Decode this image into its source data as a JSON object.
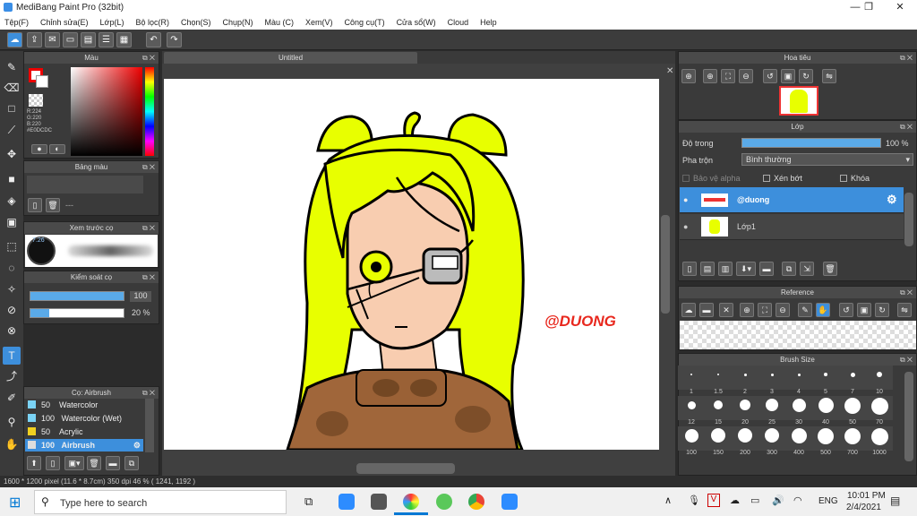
{
  "window": {
    "title": "MediBang Paint Pro (32bit)",
    "min": "—",
    "max": "❐",
    "close": "✕"
  },
  "menu": [
    "Tệp(F)",
    "Chỉnh sửa(E)",
    "Lớp(L)",
    "Bộ lọc(R)",
    "Chọn(S)",
    "Chụp(N)",
    "Màu (C)",
    "Xem(V)",
    "Công cụ(T)",
    "Cửa sổ(W)",
    "Cloud",
    "Help"
  ],
  "color_panel": {
    "title": "Màu",
    "r": "R:224",
    "g": "G:220",
    "b": "B:220",
    "hex": "#E0DCDC"
  },
  "palette_panel": {
    "title": "Bảng màu",
    "dash": "---"
  },
  "preview_panel": {
    "title": "Xem trước cọ",
    "size": "7.26"
  },
  "brush_control": {
    "title": "Kiểm soát cọ",
    "size_value": "100",
    "opacity_value": "20 %"
  },
  "brush_list": {
    "title": "Cọ: Airbrush",
    "items": [
      {
        "size": "50",
        "name": "Watercolor"
      },
      {
        "size": "100",
        "name": "Watercolor (Wet)"
      },
      {
        "size": "50",
        "name": "Acrylic"
      },
      {
        "size": "100",
        "name": "Airbrush"
      }
    ]
  },
  "document": {
    "tab_title": "Untitled",
    "signature": "@DUONG"
  },
  "navigator": {
    "title": "Hoa tiêu"
  },
  "layer_panel": {
    "title": "Lớp",
    "opacity_label": "Độ trong",
    "opacity_value": "100 %",
    "blend_label": "Pha trộn",
    "blend_value": "Bình thường",
    "protect_alpha": "Bảo vệ alpha",
    "clipping": "Xén bớt",
    "lock": "Khóa",
    "layers": [
      {
        "name": "@duong"
      },
      {
        "name": "Lớp1"
      }
    ]
  },
  "reference_panel": {
    "title": "Reference"
  },
  "brush_size_panel": {
    "title": "Brush Size",
    "sizes": [
      "1",
      "1.5",
      "2",
      "3",
      "4",
      "5",
      "7",
      "10",
      "12",
      "15",
      "20",
      "25",
      "30",
      "40",
      "50",
      "70",
      "100",
      "150",
      "200",
      "300",
      "400",
      "500",
      "700",
      "1000"
    ]
  },
  "status": {
    "text": "1600 * 1200 pixel   (11.6 * 8.7cm)   350 dpi   46 %   ( 1241, 1192 )"
  },
  "taskbar": {
    "search_placeholder": "Type here to search",
    "lang": "ENG",
    "time": "10:01 PM",
    "date": "2/4/2021"
  },
  "colors": {
    "accent": "#3d8fdc",
    "hair": "#e8ff00",
    "skin": "#f8cdb0",
    "sweater": "#a0663a"
  }
}
